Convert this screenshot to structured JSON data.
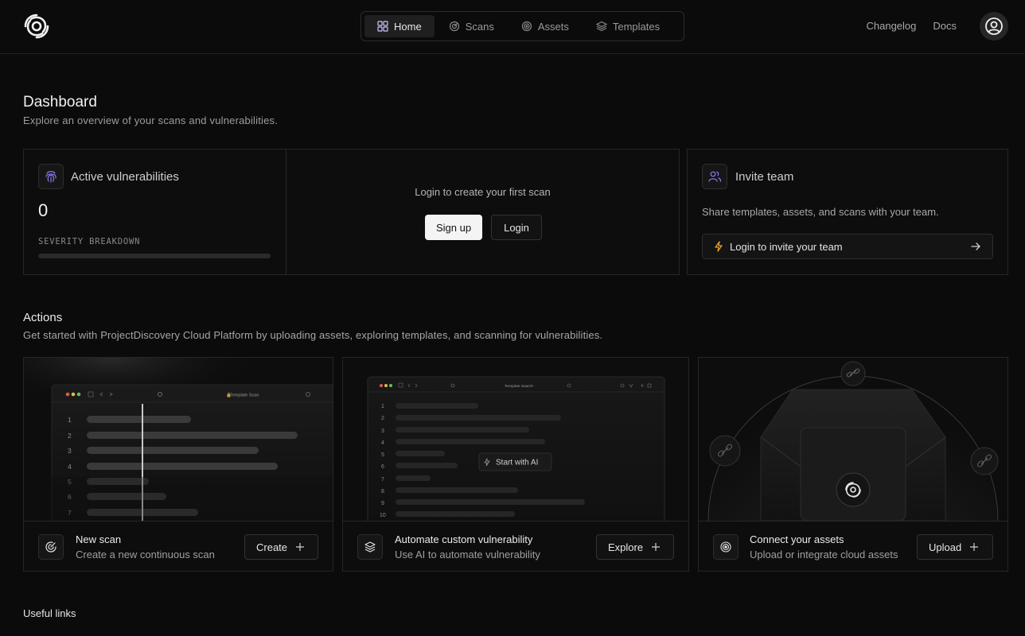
{
  "nav": {
    "tabs": [
      {
        "label": "Home",
        "icon": "grid-icon"
      },
      {
        "label": "Scans",
        "icon": "radar-icon"
      },
      {
        "label": "Assets",
        "icon": "target-icon"
      },
      {
        "label": "Templates",
        "icon": "layers-icon"
      }
    ],
    "links": [
      "Changelog",
      "Docs"
    ]
  },
  "dashboard": {
    "title": "Dashboard",
    "subtitle": "Explore an overview of your scans and vulnerabilities."
  },
  "vulns": {
    "title": "Active vulnerabilities",
    "count": "0",
    "severity_label": "SEVERITY BREAKDOWN",
    "login_message": "Login to create your first scan",
    "signup_label": "Sign up",
    "login_label": "Login"
  },
  "invite": {
    "title": "Invite team",
    "subtitle": "Share templates, assets, and scans with your team.",
    "button_label": "Login to invite your team"
  },
  "actions": {
    "title": "Actions",
    "subtitle": "Get started with ProjectDiscovery Cloud Platform by uploading assets, exploring templates, and scanning for vulnerabilities.",
    "cards": [
      {
        "title": "New scan",
        "subtitle": "Create a new continuous scan",
        "button": "Create",
        "preview_tab": "Template Scan",
        "line_numbers": [
          "1",
          "2",
          "3",
          "4",
          "5",
          "6",
          "7"
        ]
      },
      {
        "title": "Automate custom vulnerability",
        "subtitle": "Use AI to automate vulnerability",
        "button": "Explore",
        "preview_tab": "Template Search",
        "ai_label": "Start with AI",
        "line_numbers": [
          "1",
          "2",
          "3",
          "4",
          "5",
          "6",
          "7",
          "8",
          "9",
          "10"
        ]
      },
      {
        "title": "Connect your assets",
        "subtitle": "Upload or integrate cloud assets",
        "button": "Upload"
      }
    ]
  },
  "useful_links": {
    "title": "Useful links"
  },
  "colors": {
    "accent": "#8b7cf6",
    "warning": "#f5a524",
    "background": "#0b0b0b"
  }
}
